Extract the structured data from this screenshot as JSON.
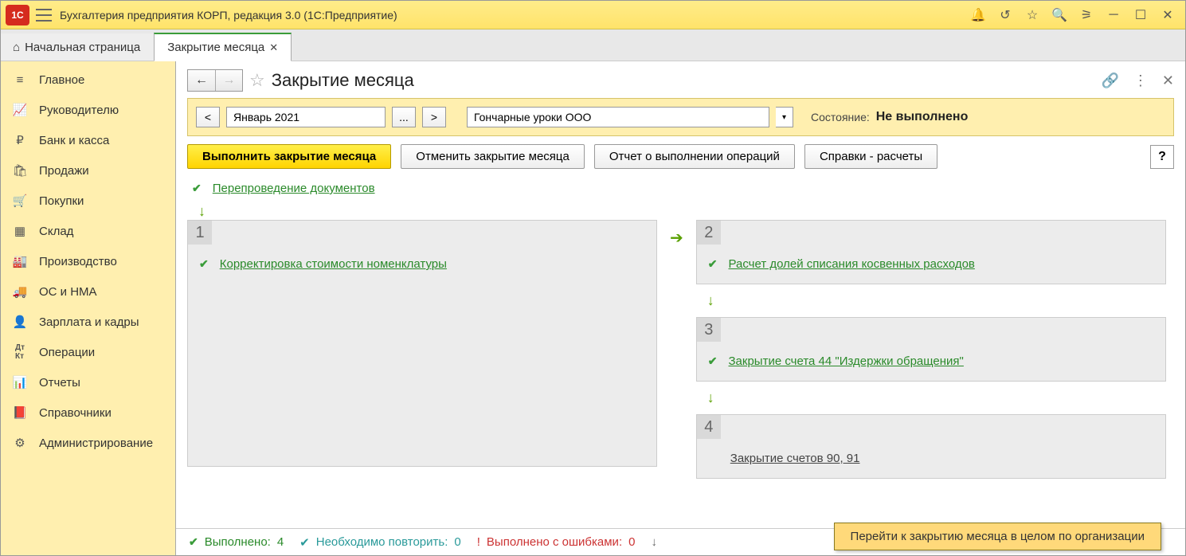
{
  "titlebar": {
    "title": "Бухгалтерия предприятия КОРП, редакция 3.0  (1С:Предприятие)"
  },
  "tabs": {
    "home": "Начальная страница",
    "active": "Закрытие месяца"
  },
  "sidebar": {
    "items": [
      {
        "label": "Главное"
      },
      {
        "label": "Руководителю"
      },
      {
        "label": "Банк и касса"
      },
      {
        "label": "Продажи"
      },
      {
        "label": "Покупки"
      },
      {
        "label": "Склад"
      },
      {
        "label": "Производство"
      },
      {
        "label": "ОС и НМА"
      },
      {
        "label": "Зарплата и кадры"
      },
      {
        "label": "Операции"
      },
      {
        "label": "Отчеты"
      },
      {
        "label": "Справочники"
      },
      {
        "label": "Администрирование"
      }
    ]
  },
  "page": {
    "title": "Закрытие месяца"
  },
  "params": {
    "prev": "<",
    "period": "Январь 2021",
    "ellipsis": "...",
    "next": ">",
    "organization": "Гончарные уроки ООО",
    "status_label": "Состояние:",
    "status_value": "Не выполнено"
  },
  "commands": {
    "execute": "Выполнить закрытие месяца",
    "cancel": "Отменить закрытие месяца",
    "report": "Отчет о выполнении операций",
    "references": "Справки - расчеты",
    "help": "?"
  },
  "process": {
    "top_op": "Перепроведение документов",
    "stage1_num": "1",
    "stage1_op": "Корректировка стоимости номенклатуры",
    "stage2_num": "2",
    "stage2_op": "Расчет долей списания косвенных расходов",
    "stage3_num": "3",
    "stage3_op": "Закрытие счета 44 \"Издержки обращения\"",
    "stage4_num": "4",
    "stage4_op": "Закрытие счетов 90, 91"
  },
  "footer": {
    "done_label": "Выполнено:",
    "done_count": "4",
    "repeat_label": "Необходимо повторить:",
    "repeat_count": "0",
    "errors_label": "Выполнено с ошибками:",
    "errors_count": "0"
  },
  "tooltip": "Перейти к закрытию месяца в целом по организации"
}
